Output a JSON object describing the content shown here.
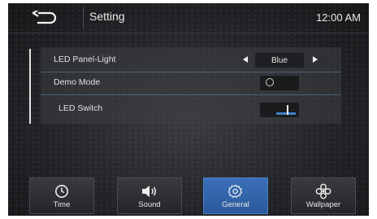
{
  "header": {
    "title": "Setting",
    "clock": "12:00 AM"
  },
  "settings": {
    "rows": [
      {
        "label": "LED Panel-Light",
        "value": "Blue"
      },
      {
        "label": "Demo Mode",
        "state": "off"
      },
      {
        "label": "LED Switch",
        "state": "on"
      }
    ]
  },
  "nav": {
    "items": [
      {
        "label": "Time",
        "icon": "clock-icon"
      },
      {
        "label": "Sound",
        "icon": "speaker-icon"
      },
      {
        "label": "General",
        "icon": "gear-icon"
      },
      {
        "label": "Wallpaper",
        "icon": "flower-icon"
      }
    ],
    "active": "General"
  },
  "colors": {
    "accent": "#3f7fc8",
    "active_tab": "#3468b0"
  }
}
